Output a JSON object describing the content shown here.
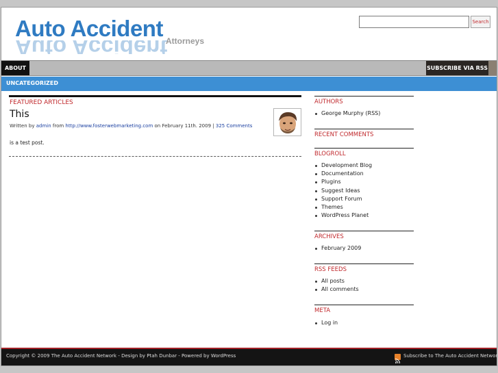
{
  "header": {
    "logo_main": "Auto Accident",
    "logo_sub": "Attorneys",
    "search_placeholder": "",
    "search_button": "Search"
  },
  "nav": {
    "about": "ABOUT",
    "subscribe": "SUBSCRIBE VIA RSS"
  },
  "categories": [
    "UNCATEGORIZED"
  ],
  "main": {
    "section_title": "FEATURED ARTICLES",
    "post": {
      "title": "This",
      "written_by": "Written by",
      "author": "admin",
      "from": "from",
      "url": "http://www.fosterwebmarketing.com",
      "date_text": "on February 11th. 2009 |",
      "comments": "325 Comments",
      "body": "is a test post."
    }
  },
  "sidebar": {
    "authors": {
      "title": "AUTHORS",
      "items": [
        "George Murphy (RSS)"
      ]
    },
    "recent_comments": {
      "title": "RECENT COMMENTS",
      "items": []
    },
    "blogroll": {
      "title": "BLOGROLL",
      "items": [
        "Development Blog",
        "Documentation",
        "Plugins",
        "Suggest Ideas",
        "Support Forum",
        "Themes",
        "WordPress Planet"
      ]
    },
    "archives": {
      "title": "ARCHIVES",
      "items": [
        "February 2009"
      ]
    },
    "rss_feeds": {
      "title": "RSS FEEDS",
      "items": [
        "All posts",
        "All comments"
      ]
    },
    "meta": {
      "title": "META",
      "items": [
        "Log in"
      ]
    }
  },
  "footer": {
    "left": "Copyright © 2009 The Auto Accident Network - Design by Ptah Dunbar - Powered by WordPress",
    "right": "Subscribe to The Auto Accident Network"
  },
  "colors": {
    "brand_blue": "#2f7bc2",
    "category_bar": "#3d8fd4",
    "accent_red": "#c0282c",
    "footer_bg": "#141414"
  }
}
